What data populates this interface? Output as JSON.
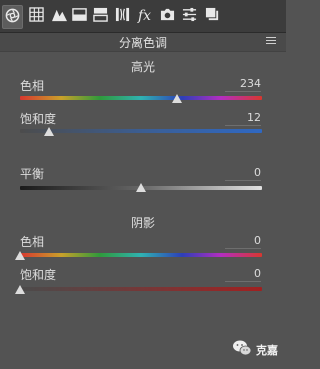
{
  "toolbar": {
    "tools": [
      {
        "icon": "aperture-icon",
        "active": true
      },
      {
        "icon": "grid-icon"
      },
      {
        "icon": "mountain-icon"
      },
      {
        "icon": "split-panel-icon"
      },
      {
        "icon": "stacked-bars-icon"
      },
      {
        "icon": "lens-icon"
      },
      {
        "icon": "fx-icon",
        "text": "fx"
      },
      {
        "icon": "camera-icon"
      },
      {
        "icon": "sliders-icon"
      },
      {
        "icon": "presets-icon"
      }
    ]
  },
  "panel": {
    "title": "分离色调"
  },
  "highlights": {
    "title": "高光",
    "hue": {
      "label": "色相",
      "value": "234",
      "position": 0.65
    },
    "saturation": {
      "label": "饱和度",
      "value": "12",
      "position": 0.12
    }
  },
  "balance": {
    "label": "平衡",
    "value": "0",
    "position": 0.5
  },
  "shadows": {
    "title": "阴影",
    "hue": {
      "label": "色相",
      "value": "0",
      "position": 0
    },
    "saturation": {
      "label": "饱和度",
      "value": "0",
      "position": 0
    }
  },
  "watermark": {
    "text": "克嘉"
  },
  "colors": {
    "panel_bg": "#535353",
    "toolbar_bg": "#3c3c3c"
  }
}
